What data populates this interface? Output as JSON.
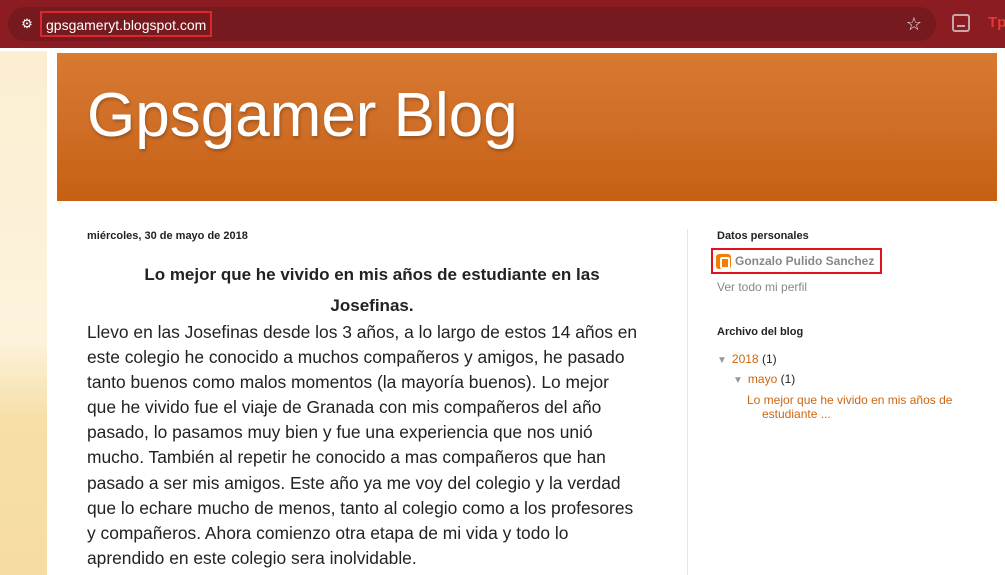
{
  "browser": {
    "url": "gpsgameryt.blogspot.com",
    "extension_label": "Tp"
  },
  "blog": {
    "title": "Gpsgamer Blog"
  },
  "post": {
    "date": "miércoles, 30 de mayo de 2018",
    "title_line1": "Lo mejor que he vivido en mis años de estudiante en las",
    "title_line2": "Josefinas.",
    "body_lines": [
      "Llevo en las Josefinas desde los 3 años, a lo largo de estos 14 años en",
      "este colegio he conocido a muchos compañeros y amigos, he pasado",
      "tanto buenos como malos momentos (la mayoría  buenos). Lo mejor",
      "que he vivido fue el viaje de Granada con mis compañeros del año",
      "pasado, lo pasamos muy bien y fue una experiencia que nos unió",
      "mucho. También al repetir he conocido a mas compañeros que han",
      "pasado a ser mis amigos. Este año ya me voy del colegio y la verdad",
      "que lo echare mucho de menos, tanto al colegio como a los profesores",
      "y compañeros. Ahora comienzo otra etapa de mi vida y todo lo",
      "aprendido en este colegio sera inolvidable."
    ]
  },
  "sidebar": {
    "profile_title": "Datos personales",
    "profile_name": "Gonzalo Pulido Sanchez",
    "profile_link": "Ver todo mi perfil",
    "archive_title": "Archivo del blog",
    "archive": {
      "year": "2018",
      "year_count": "(1)",
      "month": "mayo",
      "month_count": "(1)",
      "post_line1": "Lo mejor que he vivido en mis años de",
      "post_line2": "estudiante ..."
    },
    "toggle_symbol": "▼"
  },
  "colors": {
    "chrome": "#8b1c22",
    "header": "#cf6e26",
    "link": "#cc6611",
    "highlight": "#e0121c"
  }
}
